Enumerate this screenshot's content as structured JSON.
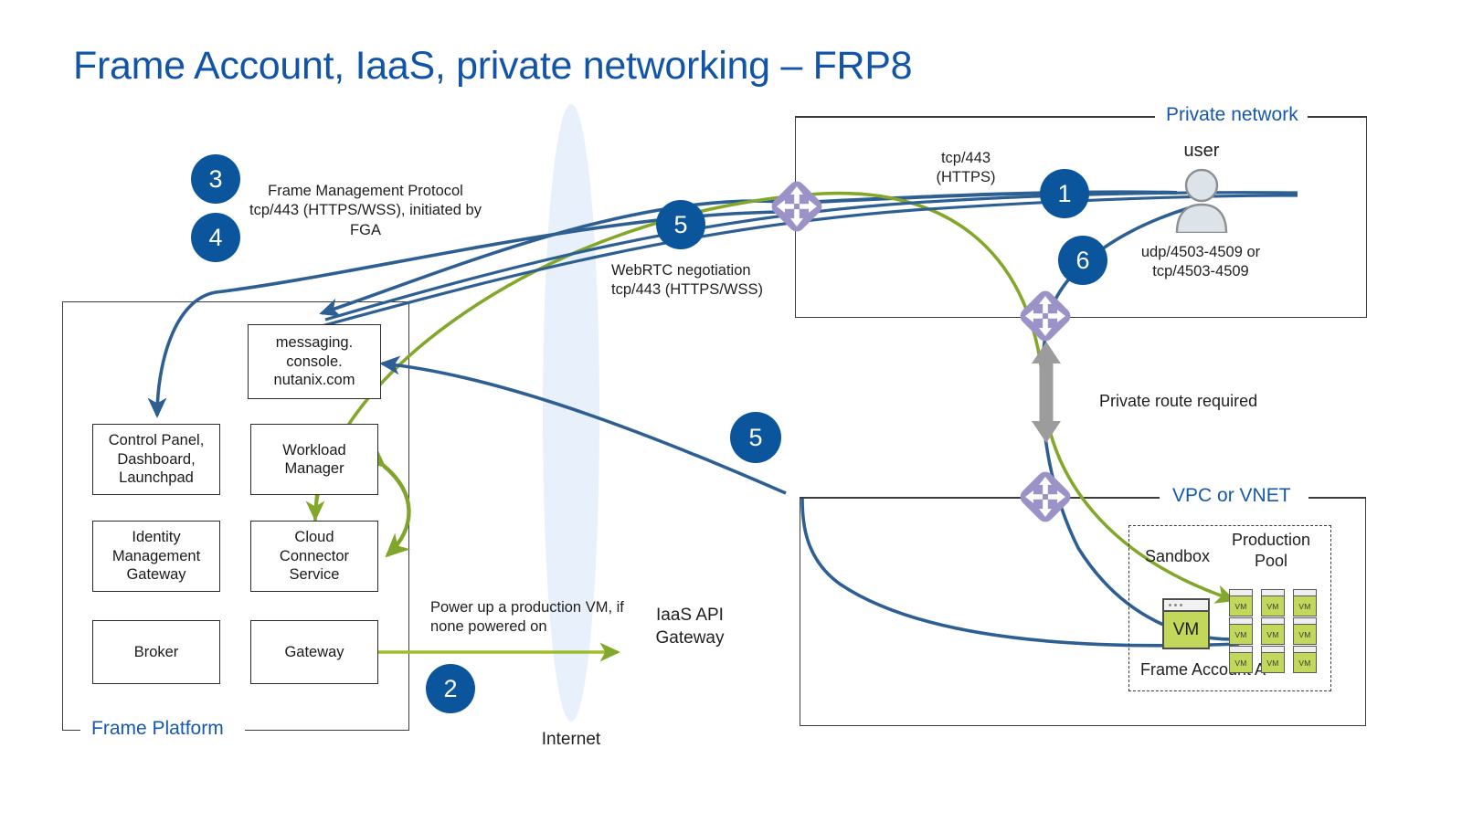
{
  "title": "Frame Account, IaaS, private networking – FRP8",
  "accent_colors": {
    "title_blue": "#1255a8",
    "badge_blue": "#0b559c",
    "line_blue": "#2d5f93",
    "line_green": "#83a72a",
    "router_purple": "#9b93c8",
    "vm_green": "#c2d85a",
    "internet_fill": "#e8f0fb",
    "gray_arrow": "#9c9c9c"
  },
  "groups": {
    "frame_platform": {
      "label": "Frame Platform"
    },
    "private_network": {
      "label": "Private network"
    },
    "vpc_vnet": {
      "label": "VPC or VNET"
    },
    "frame_account": {
      "label": "Frame Account A"
    }
  },
  "platform_nodes": [
    {
      "id": "messaging",
      "label": "messaging.\nconsole.\nnutanix.com"
    },
    {
      "id": "control-panel",
      "label": "Control Panel,\nDashboard,\nLaunchpad"
    },
    {
      "id": "workload-manager",
      "label": "Workload\nManager"
    },
    {
      "id": "identity-management-gateway",
      "label": "Identity\nManagement\nGateway"
    },
    {
      "id": "cloud-connector-service",
      "label": "Cloud\nConnector\nService"
    },
    {
      "id": "broker",
      "label": "Broker"
    },
    {
      "id": "gateway",
      "label": "Gateway"
    }
  ],
  "badges": [
    {
      "id": "badge-1",
      "number": "1"
    },
    {
      "id": "badge-2",
      "number": "2"
    },
    {
      "id": "badge-3",
      "number": "3"
    },
    {
      "id": "badge-4",
      "number": "4"
    },
    {
      "id": "badge-5-top",
      "number": "5"
    },
    {
      "id": "badge-5-bottom",
      "number": "5"
    },
    {
      "id": "badge-6",
      "number": "6"
    }
  ],
  "annotations": {
    "frame_management_protocol": "Frame Management Protocol\ntcp/443 (HTTPS/WSS), initiated by\nFGA",
    "webrtc_negotiation": "WebRTC negotiation\ntcp/443 (HTTPS/WSS)",
    "tcp443_https": "tcp/443\n(HTTPS)",
    "udp_tcp_ports": "udp/4503-4509 or\ntcp/4503-4509",
    "private_route_required": "Private route required",
    "power_up_vm": "Power up a production VM, if\nnone powered on",
    "iaas_api_gateway": "IaaS API\nGateway",
    "internet": "Internet",
    "user": "user",
    "sandbox": "Sandbox",
    "production_pool": "Production\nPool"
  },
  "vms": {
    "sandbox_label": "VM",
    "pool_label": "VM",
    "pool_rows": 3,
    "pool_cols": 3
  }
}
